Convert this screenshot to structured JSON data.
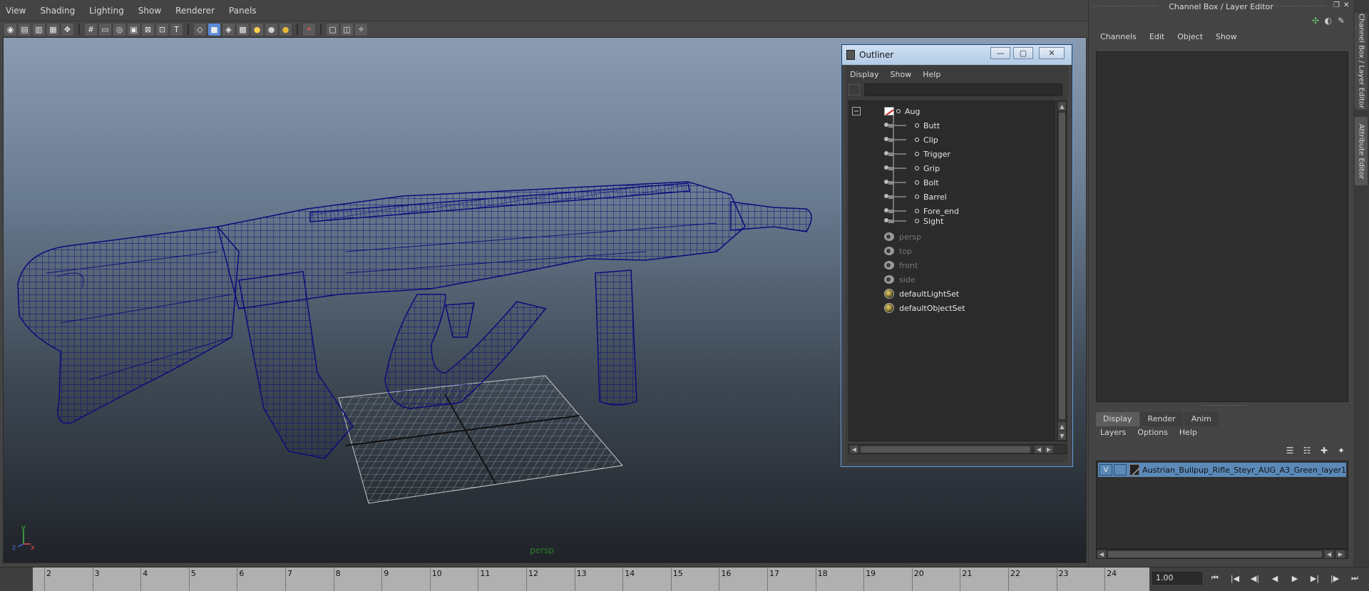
{
  "viewport": {
    "menu": [
      "View",
      "Shading",
      "Lighting",
      "Show",
      "Renderer",
      "Panels"
    ],
    "toolbar_icons": [
      "camera-select-icon",
      "camera-attributes-icon",
      "bookmark-icon",
      "image-plane-icon",
      "two-d-pan-icon",
      "grease-pencil-icon",
      "grid-icon",
      "film-gate-icon",
      "resolution-gate-icon",
      "gate-mask-icon",
      "field-chart-icon",
      "safe-action-icon",
      "safe-title-icon",
      "wireframe-icon",
      "smooth-shade-icon",
      "shaded-wireframe-icon",
      "textured-icon",
      "use-all-lights-icon",
      "shadows-icon",
      "ambient-occlusion-icon",
      "isolate-select-icon",
      "xray-icon",
      "xray-joints-icon",
      "xray-components-icon"
    ],
    "camera_label": "persp",
    "axis_labels": [
      "y",
      "x",
      "z"
    ],
    "colors": {
      "wireframe": "#0b0b7a",
      "grid": "#c8c8c8"
    }
  },
  "outliner": {
    "title": "Outliner",
    "menu": [
      "Display",
      "Show",
      "Help"
    ],
    "root": {
      "label": "Aug",
      "icon": "group-icon"
    },
    "children": [
      {
        "label": "Butt",
        "icon": "mesh-icon"
      },
      {
        "label": "Clip",
        "icon": "mesh-icon"
      },
      {
        "label": "Trigger",
        "icon": "mesh-icon"
      },
      {
        "label": "Grip",
        "icon": "mesh-icon"
      },
      {
        "label": "Bolt",
        "icon": "mesh-icon"
      },
      {
        "label": "Barrel",
        "icon": "mesh-icon"
      },
      {
        "label": "Fore_end",
        "icon": "mesh-icon"
      },
      {
        "label": "Sight",
        "icon": "mesh-icon"
      }
    ],
    "cameras": [
      "persp",
      "top",
      "front",
      "side"
    ],
    "sets": [
      "defaultLightSet",
      "defaultObjectSet"
    ]
  },
  "channel_box": {
    "title": "Channel Box / Layer Editor",
    "menu": [
      "Channels",
      "Edit",
      "Object",
      "Show"
    ]
  },
  "layer_editor": {
    "tabs": [
      "Display",
      "Render",
      "Anim"
    ],
    "active_tab": "Display",
    "menu": [
      "Layers",
      "Options",
      "Help"
    ],
    "layer": {
      "visible": "V",
      "name": "Austrian_Bullpup_Rifle_Steyr_AUG_A3_Green_layer1"
    }
  },
  "side_tabs": [
    "Channel Box / Layer Editor",
    "Attribute Editor"
  ],
  "timeline": {
    "ticks": [
      "2",
      "3",
      "4",
      "5",
      "6",
      "7",
      "8",
      "9",
      "10",
      "11",
      "12",
      "13",
      "14",
      "15",
      "16",
      "17",
      "18",
      "19",
      "20",
      "21",
      "22",
      "23",
      "24"
    ],
    "current_frame": "1.00",
    "playback_icons": [
      "go-to-start-icon",
      "step-back-key-icon",
      "step-back-frame-icon",
      "play-back-icon",
      "play-forward-icon",
      "step-forward-key-icon",
      "step-forward-frame-icon",
      "go-to-end-icon"
    ],
    "playback_glyphs": [
      "⏮",
      "|◀",
      "◀|",
      "◀",
      "▶",
      "▶|",
      "|▶",
      "⏭"
    ]
  }
}
